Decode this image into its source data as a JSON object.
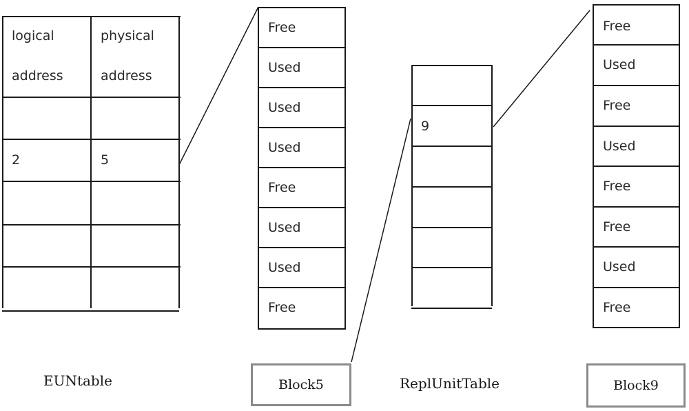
{
  "eun_table": {
    "caption": "EUNtable",
    "headers": [
      "logical",
      "physical"
    ],
    "headers_line2": [
      "address",
      "address"
    ],
    "rows": [
      [
        "",
        ""
      ],
      [
        "2",
        "5"
      ],
      [
        "",
        ""
      ],
      [
        "",
        ""
      ],
      [
        "",
        ""
      ]
    ]
  },
  "block5": {
    "label": "Block5",
    "pages": [
      "Free",
      "Used",
      "Used",
      "Used",
      "Free",
      "Used",
      "Used",
      "Free"
    ]
  },
  "repl_unit_table": {
    "caption": "ReplUnitTable",
    "rows": [
      "",
      "9",
      "",
      "",
      "",
      ""
    ]
  },
  "block9": {
    "label": "Block9",
    "pages": [
      "Free",
      "Used",
      "Free",
      "Used",
      "Free",
      "Free",
      "Used",
      "Free"
    ]
  }
}
